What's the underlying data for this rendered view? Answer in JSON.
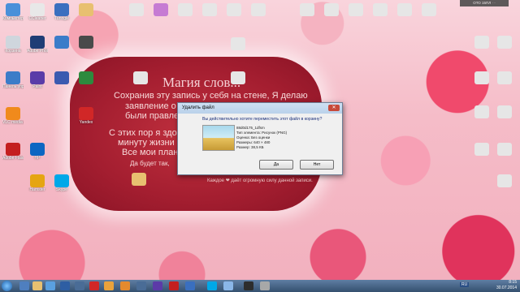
{
  "overlay": {
    "title": "Магия слов...",
    "lines": [
      "Сохранив эту запись у себя на стене, Я делаю",
      "заявление о том, что",
      "были правлена",
      "С этих пор я здо",
      "минуту жизни пр",
      "Все мои планы",
      "Да будет так,"
    ],
    "footer": "Каждое ❤ даёт огромную силу данной записи."
  },
  "dialog": {
    "title": "Удалить файл",
    "close_label": "✕",
    "question": "Вы действительно хотите переместить этот файл в корзину?",
    "info": [
      "88d0d175_1dfsm",
      "Тип элемента: Рисунок (PNG)",
      "Оценка: Без оценки",
      "Размеры: 640 × 480",
      "Размер: 38,5 КБ"
    ],
    "yes_label": "Да",
    "no_label": "Нет"
  },
  "desktop_icons": [
    {
      "label": "Компьютер",
      "color": "#4a90d9"
    },
    {
      "label": "CCleaner",
      "color": "#e8e8e8"
    },
    {
      "label": "Tunngle",
      "color": "#3a6fbf"
    },
    {
      "label": "",
      "color": "#e8c070"
    },
    {
      "label": "",
      "color": "#c67bd3"
    },
    {
      "label": "",
      "color": "#e6e6e6"
    },
    {
      "label": "",
      "color": "#e6e6e6"
    },
    {
      "label": "",
      "color": "#e6e6e6"
    },
    {
      "label": "",
      "color": "#e6e6e6"
    },
    {
      "label": "Корзина",
      "color": "#cfd6dd"
    },
    {
      "label": "Adobe Photoshop",
      "color": "#1f3d75"
    },
    {
      "label": "",
      "color": "#3b7cc9"
    },
    {
      "label": "",
      "color": "#4a4a4a"
    },
    {
      "label": "",
      "color": "#c0392b"
    },
    {
      "label": "",
      "color": "#3d7bd1"
    },
    {
      "label": "Панель управления",
      "color": "#3c7cc8"
    },
    {
      "label": "Paint",
      "color": "#5a3ca8"
    },
    {
      "label": "",
      "color": "#3b5ab0"
    },
    {
      "label": "",
      "color": "#2d8a3e"
    },
    {
      "label": "VLC media player",
      "color": "#f08a1c"
    },
    {
      "label": "Adobe Flash",
      "color": "#c41f1f"
    },
    {
      "label": "Skype",
      "color": "#00a8e8"
    },
    {
      "label": "Yandex",
      "color": "#d12727"
    },
    {
      "label": "HP",
      "color": "#0c66c2"
    },
    {
      "label": "Hamster",
      "color": "#e5a512"
    }
  ],
  "taskbar": {
    "time": "8:15",
    "date": "30.07.2014",
    "lang": "RU",
    "tooltip": "ОТО 15ПЛ ·  ·"
  }
}
